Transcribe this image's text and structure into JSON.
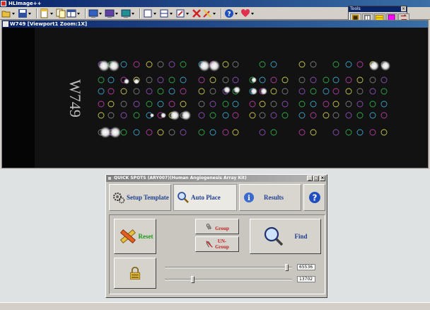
{
  "app": {
    "title": "HLImage++"
  },
  "toolbar": {
    "icons": [
      "open-icon",
      "save-icon",
      "new-icon",
      "copy-icon",
      "layout-icon",
      "image-icon",
      "chart-icon",
      "monitor-icon",
      "rectangle-icon",
      "split-icon",
      "edit-icon",
      "delete-icon",
      "tools-icon",
      "help-icon",
      "favorite-icon"
    ]
  },
  "tools_palette": {
    "title": "Tools",
    "close": "×",
    "colors": [
      "#b8860b",
      "#6e6e6e",
      "#ffd700",
      "#ff00ff",
      "#c0c0c0"
    ]
  },
  "viewport": {
    "title": "W749 [Viewport1 Zoom:1X]",
    "handwriting": "W749"
  },
  "dialog": {
    "title": "QUICK SPOTS (ARY007)(Human Angiogenesis Array Kit)",
    "controls": [
      "_",
      "□",
      "×"
    ],
    "tabs": [
      {
        "label": "Setup Template",
        "active": false
      },
      {
        "label": "Auto Place",
        "active": true
      },
      {
        "label": "Results",
        "active": false
      }
    ],
    "help_label": "?",
    "reset_label": "Reset",
    "group_label": "Group",
    "ungroup_label_1": "UN-",
    "ungroup_label_2": "Group",
    "find_label": "Find",
    "slider_top_value": "65536",
    "slider_bottom_value": "13702",
    "slider_top_level": 0.97,
    "slider_bottom_level": 0.21
  },
  "colors": {
    "title_blue": "#0a246a",
    "reset_green": "#1a9a1a",
    "group_red": "#c02020",
    "find_blue": "#1f3f8f"
  }
}
